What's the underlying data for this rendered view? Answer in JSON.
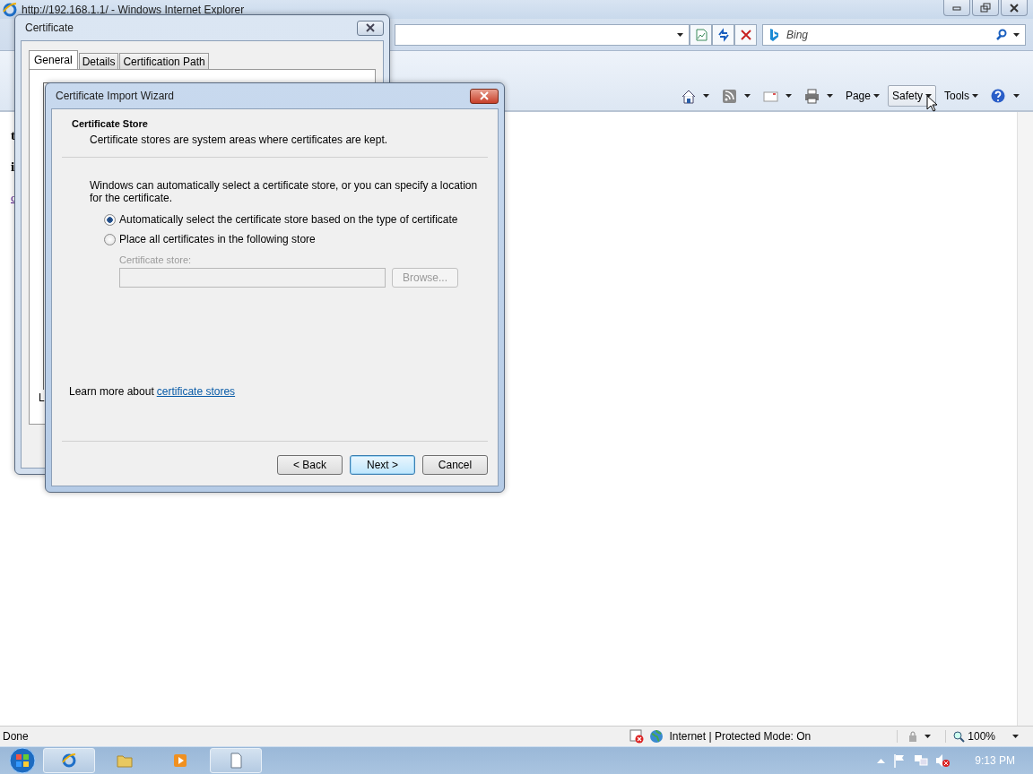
{
  "browser": {
    "title": "http://192.168.1.1/ - Windows Internet Explorer",
    "search": {
      "placeholder": "Bing"
    },
    "command_bar": [
      {
        "kind": "icon"
      },
      {
        "kind": "icon"
      },
      {
        "kind": "icon"
      },
      {
        "kind": "icon"
      },
      {
        "kind": "menu",
        "label": "Page",
        "hovered": false
      },
      {
        "kind": "menu",
        "label": "Safety",
        "hovered": true
      },
      {
        "kind": "menu",
        "label": "Tools",
        "hovered": false
      },
      {
        "kind": "icon"
      }
    ],
    "page_text": [
      "t",
      "i",
      "c"
    ]
  },
  "certificate_dialog": {
    "title": "Certificate",
    "tabs": [
      {
        "label": "General",
        "selected": true
      },
      {
        "label": "Details",
        "selected": false
      },
      {
        "label": "Certification Path",
        "selected": false
      }
    ],
    "partial_text": "L"
  },
  "wizard": {
    "title": "Certificate Import Wizard",
    "heading": "Certificate Store",
    "subheading": "Certificate stores are system areas where certificates are kept.",
    "intro": "Windows can automatically select a certificate store, or you can specify a location for the certificate.",
    "options": [
      {
        "label": "Automatically select the certificate store based on the type of certificate",
        "selected": true
      },
      {
        "label": "Place all certificates in the following store",
        "selected": false
      }
    ],
    "store": {
      "label": "Certificate store:",
      "disabled": true
    },
    "browse": {
      "label": "Browse...",
      "disabled": true
    },
    "learn_more": {
      "text": "Learn more about",
      "link": "certificate stores"
    },
    "buttons": [
      {
        "label": "< Back",
        "default": false
      },
      {
        "label": "Next >",
        "default": true
      },
      {
        "label": "Cancel",
        "default": false
      }
    ]
  },
  "status_bar": {
    "text": "Done",
    "zone": "Internet | Protected Mode: On",
    "zoom": "100%"
  },
  "taskbar": {
    "clock": "9:13 PM"
  }
}
